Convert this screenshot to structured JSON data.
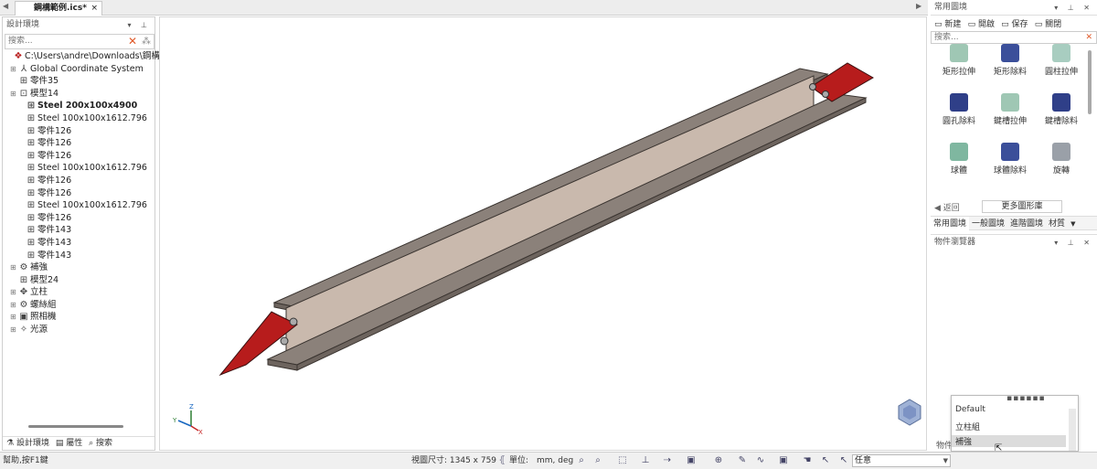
{
  "tab": {
    "title": "鋼構範例.ics*",
    "close": "×",
    "left_arrow": "◀",
    "right_arrow": "▶"
  },
  "left_panel": {
    "title": "設計環境",
    "search_placeholder": "搜索...",
    "items": [
      {
        "label": "C:\\Users\\andre\\Downloads\\鋼構範",
        "icon": "scene-icon",
        "bold": false
      },
      {
        "label": "Global Coordinate System",
        "icon": "coordinate-icon",
        "bold": false
      },
      {
        "label": "零件35",
        "icon": "part-icon",
        "bold": false
      },
      {
        "label": "模型14",
        "icon": "model-icon",
        "bold": false
      },
      {
        "label": "Steel 200x100x4900",
        "icon": "part-icon",
        "bold": true
      },
      {
        "label": "Steel 100x100x1612.796",
        "icon": "part-icon",
        "bold": false
      },
      {
        "label": "零件126",
        "icon": "part-icon",
        "bold": false
      },
      {
        "label": "零件126",
        "icon": "part-icon",
        "bold": false
      },
      {
        "label": "零件126",
        "icon": "part-icon",
        "bold": false
      },
      {
        "label": "Steel 100x100x1612.796",
        "icon": "part-icon",
        "bold": false
      },
      {
        "label": "零件126",
        "icon": "part-icon",
        "bold": false
      },
      {
        "label": "零件126",
        "icon": "part-icon",
        "bold": false
      },
      {
        "label": "Steel 100x100x1612.796",
        "icon": "part-icon",
        "bold": false
      },
      {
        "label": "零件126",
        "icon": "part-icon",
        "bold": false
      },
      {
        "label": "零件143",
        "icon": "part-icon",
        "bold": false
      },
      {
        "label": "零件143",
        "icon": "part-icon",
        "bold": false
      },
      {
        "label": "零件143",
        "icon": "part-icon",
        "bold": false
      },
      {
        "label": "補強",
        "icon": "reinforce-icon",
        "bold": false
      },
      {
        "label": "模型24",
        "icon": "part-icon",
        "bold": false
      },
      {
        "label": "立柱",
        "icon": "column-icon",
        "bold": false
      },
      {
        "label": "螺絲組",
        "icon": "screw-icon",
        "bold": false
      },
      {
        "label": "照相機",
        "icon": "camera-icon",
        "bold": false
      },
      {
        "label": "光源",
        "icon": "light-icon",
        "bold": false
      }
    ],
    "bottom_tabs": [
      "設計環境",
      "屬性",
      "搜索"
    ]
  },
  "right_panel": {
    "title": "常用圖境",
    "toolbar": [
      "新建",
      "開啟",
      "保存",
      "關閉"
    ],
    "search_placeholder": "搜索...",
    "shapes": [
      {
        "label": "矩形拉伸",
        "color": "#9fc7b4"
      },
      {
        "label": "矩形除料",
        "color": "#3b4f9a"
      },
      {
        "label": "圓柱拉伸",
        "color": "#a8cdc0"
      },
      {
        "label": "圓孔除料",
        "color": "#2f3f88"
      },
      {
        "label": "鍵槽拉伸",
        "color": "#9fc7b4"
      },
      {
        "label": "鍵槽除料",
        "color": "#2f3f88"
      },
      {
        "label": "球體",
        "color": "#7fb7a0"
      },
      {
        "label": "球體除料",
        "color": "#3b4f9a"
      },
      {
        "label": "旋轉",
        "color": "#9aa0a8"
      }
    ],
    "back_label": "返回",
    "more_label": "更多圖形庫",
    "tabs": [
      "常用圖境",
      "一般圖境",
      "進階圖境",
      "材質"
    ]
  },
  "object_panel": {
    "title": "物件瀏覽器",
    "dropdown": [
      "Default",
      "立柱組",
      "補強"
    ],
    "label": "物件"
  },
  "status": {
    "help": "幫助,按F1鍵",
    "view_size": "視圖尺寸: 1345 x 759",
    "unit_label": "單位:",
    "unit_value": "mm, deg",
    "select_mode": "任意"
  }
}
